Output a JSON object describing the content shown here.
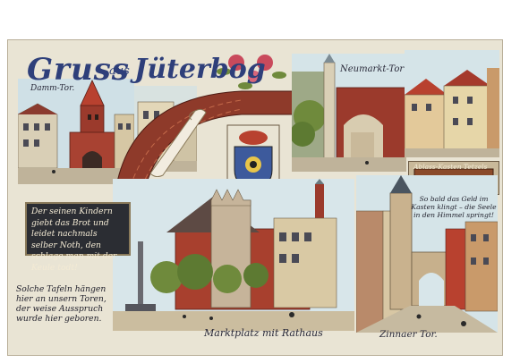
{
  "card": {
    "title_greeting": "Gruss",
    "title_preposition": "aus",
    "title_city": "Jüterbog"
  },
  "captions": {
    "damm_tor": "Damm-Tor.",
    "neumarkt_tor": "Neumarkt-Tor",
    "ablass_kasten": "Ablass-Kasten Tetzels",
    "marktplatz": "Marktplatz mit Rathaus",
    "zinnaer_tor": "Zinnaer Tor."
  },
  "plaque_text": "Der seinen Kindern giebt das Brot und leidet nachmals selber Noth, den schlage man mit der Keule todt!",
  "note_text": "Solche Tafeln hängen hier an unsern Toren, der weise Ausspruch wurde hier geboren.",
  "chest_text": "So bald das Geld im Kasten klingt – die Seele in den Himmel springt!",
  "colors": {
    "sky": "#cfe0e6",
    "brick": "#9b3a2c",
    "roof_red": "#b8412f",
    "stone": "#c9b99a",
    "title_blue": "#2e3f7a",
    "tree_green": "#6f8a3c"
  }
}
